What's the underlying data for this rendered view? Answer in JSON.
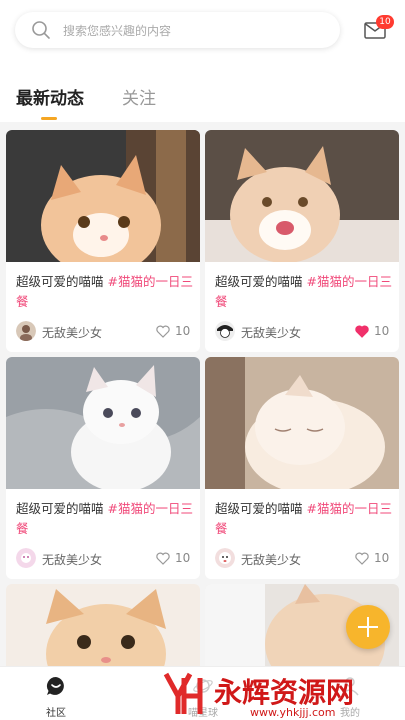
{
  "search": {
    "placeholder": "搜索您感兴趣的内容"
  },
  "mail": {
    "icon": "mail-icon",
    "badge": "10"
  },
  "tabs": [
    {
      "label": "最新动态",
      "active": true
    },
    {
      "label": "关注",
      "active": false
    }
  ],
  "posts": [
    {
      "title": "超级可爱的喵喵 ",
      "tag": "#猫猫的一日三餐",
      "author": "无敌美少女",
      "likes": "10",
      "liked": false
    },
    {
      "title": "超级可爱的喵喵 ",
      "tag": "#猫猫的一日三餐",
      "author": "无敌美少女",
      "likes": "10",
      "liked": true
    },
    {
      "title": "超级可爱的喵喵 ",
      "tag": "#猫猫的一日三餐",
      "author": "无敌美少女",
      "likes": "10",
      "liked": false
    },
    {
      "title": "超级可爱的喵喵 ",
      "tag": "#猫猫的一日三餐",
      "author": "无敌美少女",
      "likes": "10",
      "liked": false
    }
  ],
  "fab": {
    "icon": "plus-icon"
  },
  "nav": [
    {
      "label": "社区",
      "icon": "chat-bubble-icon",
      "active": true
    },
    {
      "label": "喵星球",
      "icon": "planet-icon",
      "active": false
    },
    {
      "label": "我的",
      "icon": "user-icon",
      "active": false
    }
  ],
  "watermark": {
    "text": "永辉资源网",
    "url": "www.yhkjjj.com"
  },
  "colors": {
    "accent": "#f5a623",
    "tag": "#f04a7a",
    "liked": "#f0306a",
    "fab": "#f7b52c"
  }
}
